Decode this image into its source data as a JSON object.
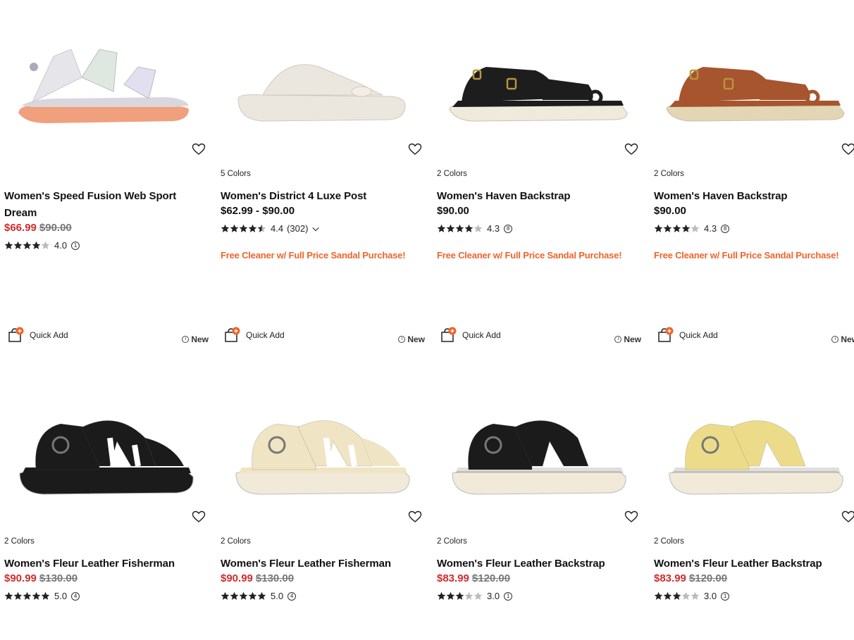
{
  "rows": [
    {
      "products": [
        {
          "name": "Women's Speed Fusion Web Sport Dream",
          "colors": "",
          "sale_price": "$66.99",
          "original_price": "$90.00",
          "price_range": "",
          "rating": "4.0",
          "stars": 4,
          "review_count": "1",
          "promo": "",
          "shoe_color": "#e6e6ea",
          "sole_color": "#f0a07c"
        },
        {
          "name": "Women's District 4 Luxe Post",
          "colors": "5 Colors",
          "sale_price": "",
          "original_price": "",
          "price_range": "$62.99 - $90.00",
          "rating": "4.4",
          "stars": 4.5,
          "review_count": "(302)",
          "promo": "Free Cleaner w/ Full Price Sandal Purchase!",
          "shoe_color": "#ebe7df",
          "sole_color": "#ebe7df"
        },
        {
          "name": "Women's Haven Backstrap",
          "colors": "2 Colors",
          "sale_price": "",
          "original_price": "",
          "price_range": "$90.00",
          "rating": "4.3",
          "stars": 4,
          "review_count": "8",
          "promo": "Free Cleaner w/ Full Price Sandal Purchase!",
          "shoe_color": "#1d1d1d",
          "sole_color": "#efeadc"
        },
        {
          "name": "Women's Haven Backstrap",
          "colors": "2 Colors",
          "sale_price": "",
          "original_price": "",
          "price_range": "$90.00",
          "rating": "4.3",
          "stars": 4,
          "review_count": "8",
          "promo": "Free Cleaner w/ Full Price Sandal Purchase!",
          "shoe_color": "#a6552e",
          "sole_color": "#e2d6b4"
        }
      ]
    },
    {
      "products": [
        {
          "name": "Women's Fleur Leather Fisherman",
          "colors": "2 Colors",
          "sale_price": "$90.99",
          "original_price": "$130.00",
          "price_range": "",
          "rating": "5.0",
          "stars": 5,
          "review_count": "4",
          "promo": "",
          "shoe_color": "#1b1b1b",
          "sole_color": "#1b1b1b"
        },
        {
          "name": "Women's Fleur Leather Fisherman",
          "colors": "2 Colors",
          "sale_price": "$90.99",
          "original_price": "$130.00",
          "price_range": "",
          "rating": "5.0",
          "stars": 5,
          "review_count": "4",
          "promo": "",
          "shoe_color": "#efe4c4",
          "sole_color": "#f1ead8"
        },
        {
          "name": "Women's Fleur Leather Backstrap",
          "colors": "2 Colors",
          "sale_price": "$83.99",
          "original_price": "$120.00",
          "price_range": "",
          "rating": "3.0",
          "stars": 3,
          "review_count": "1",
          "promo": "",
          "shoe_color": "#1b1b1b",
          "sole_color": "#f1ead8"
        },
        {
          "name": "Women's Fleur Leather Backstrap",
          "colors": "2 Colors",
          "sale_price": "$83.99",
          "original_price": "$120.00",
          "price_range": "",
          "rating": "3.0",
          "stars": 3,
          "review_count": "1",
          "promo": "",
          "shoe_color": "#ecdc8a",
          "sole_color": "#f1ead8"
        }
      ]
    }
  ],
  "quick_add_label": "Quick Add",
  "new_label": "New",
  "quick_add_row_visible": true
}
